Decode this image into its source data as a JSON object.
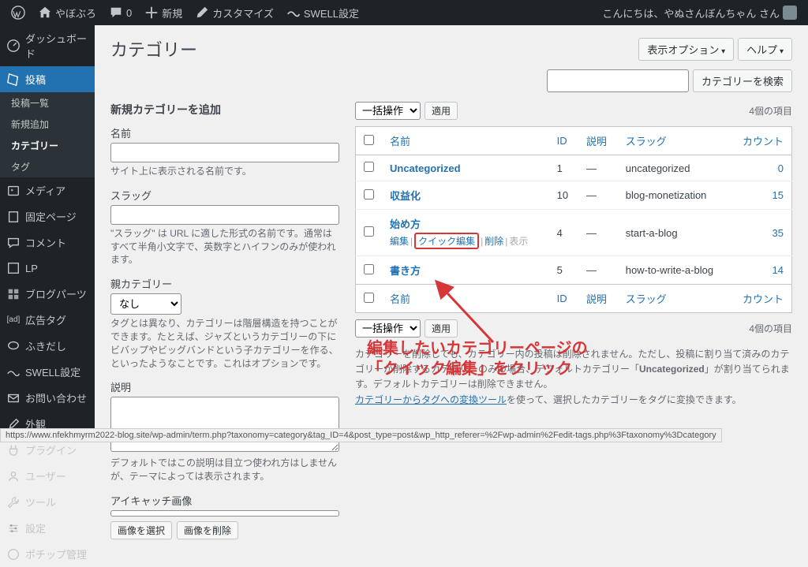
{
  "adminbar": {
    "site_name": "やぼぶろ",
    "comments": "0",
    "new": "新規",
    "customize": "カスタマイズ",
    "swell": "SWELL設定",
    "greeting": "こんにちは、やぬさんぼんちゃん さん"
  },
  "menu": {
    "dashboard": "ダッシュボード",
    "posts": "投稿",
    "posts_sub": {
      "all": "投稿一覧",
      "new": "新規追加",
      "cat": "カテゴリー",
      "tag": "タグ"
    },
    "media": "メディア",
    "pages": "固定ページ",
    "comments": "コメント",
    "lp": "LP",
    "blogparts": "ブログパーツ",
    "adtag": "広告タグ",
    "fukidashi": "ふきだし",
    "swell": "SWELL設定",
    "contact": "お問い合わせ",
    "appearance": "外観",
    "plugins": "プラグイン",
    "users": "ユーザー",
    "tools": "ツール",
    "settings": "設定",
    "pochipp": "ポチップ管理"
  },
  "page_title": "カテゴリー",
  "screen_options": "表示オプション",
  "help": "ヘルプ",
  "search_btn": "カテゴリーを検索",
  "form": {
    "heading": "新規カテゴリーを追加",
    "name_label": "名前",
    "name_desc": "サイト上に表示される名前です。",
    "slug_label": "スラッグ",
    "slug_desc": "\"スラッグ\" は URL に適した形式の名前です。通常はすべて半角小文字で、英数字とハイフンのみが使われます。",
    "parent_label": "親カテゴリー",
    "parent_option": "なし",
    "parent_desc": "タグとは異なり、カテゴリーは階層構造を持つことができます。たとえば、ジャズというカテゴリーの下にビバップやビッグバンドという子カテゴリーを作る、といったようなことです。これはオプションです。",
    "desc_label": "説明",
    "desc_desc": "デフォルトではこの説明は目立つ使われ方はしませんが、テーマによっては表示されます。",
    "thumb_label": "アイキャッチ画像",
    "thumb_select": "画像を選択",
    "thumb_remove": "画像を削除"
  },
  "bulk": {
    "action": "一括操作",
    "apply": "適用"
  },
  "item_count": "4個の項目",
  "table": {
    "headers": {
      "name": "名前",
      "id": "ID",
      "desc": "説明",
      "slug": "スラッグ",
      "count": "カウント"
    },
    "rows": [
      {
        "name": "Uncategorized",
        "id": "1",
        "desc": "—",
        "slug": "uncategorized",
        "count": "0"
      },
      {
        "name": "収益化",
        "id": "10",
        "desc": "—",
        "slug": "blog-monetization",
        "count": "15"
      },
      {
        "name": "始め方",
        "id": "4",
        "desc": "—",
        "slug": "start-a-blog",
        "count": "35"
      },
      {
        "name": "書き方",
        "id": "5",
        "desc": "—",
        "slug": "how-to-write-a-blog",
        "count": "14"
      }
    ],
    "row_actions": {
      "edit": "編集",
      "quick_edit": "クイック編集",
      "delete": "削除",
      "view": "表示"
    }
  },
  "notes": {
    "line1": "カテゴリーを削除しても、カテゴリー内の投稿は削除されません。ただし、投稿に割り当て済みのカテゴリーが削除するカテゴリーのみの場合、デフォルトカテゴリー「",
    "uncat": "Uncategorized",
    "line1b": "」が割り当てられます。デフォルトカテゴリーは削除できません。",
    "link": "カテゴリーからタグへの変換ツール",
    "line2": "を使って、選択したカテゴリーをタグに変換できます。"
  },
  "annotation": {
    "line1": "編集したいカテゴリーページの",
    "line2": "「クイック編集」をクリック"
  },
  "status_url": "https://www.nfekhmyrm2022-blog.site/wp-admin/term.php?taxonomy=category&tag_ID=4&post_type=post&wp_http_referer=%2Fwp-admin%2Fedit-tags.php%3Ftaxonomy%3Dcategory"
}
